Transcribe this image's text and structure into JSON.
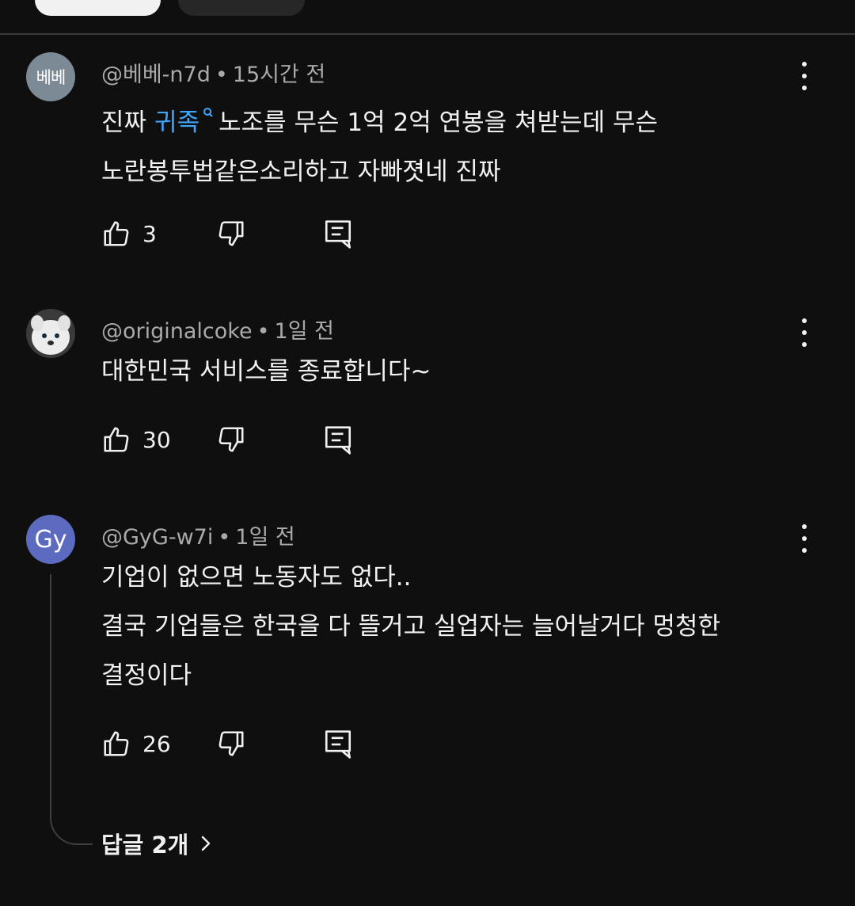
{
  "comments": [
    {
      "avatar_text": "베베",
      "author": "@베베-n7d",
      "time": "15시간 전",
      "text_prefix": "진짜",
      "hashtag": "귀족",
      "line1_rest": "노조를 무슨 1억 2억 연봉을 쳐받는데 무슨",
      "line2": "노란봉투법같은소리하고 자빠졋네 진짜",
      "likes": "3"
    },
    {
      "avatar_icon": "dog-photo-avatar",
      "author": "@originalcoke",
      "time": "1일 전",
      "line1": "대한민국 서비스를 종료합니다~",
      "likes": "30"
    },
    {
      "avatar_text": "Gy",
      "author": "@GyG-w7i",
      "time": "1일 전",
      "line1": "기업이 없으면 노동자도 없다..",
      "line2": "결국 기업들은 한국을 다 뜰거고 실업자는 늘어날거다 멍청한",
      "line3": "결정이다",
      "likes": "26",
      "replies_label": "답글 2개"
    }
  ],
  "separator": "•",
  "icons": {
    "like": "thumb-up-icon",
    "dislike": "thumb-down-icon",
    "reply": "reply-comment-icon",
    "more": "more-vertical-icon",
    "chevron": "chevron-right-icon",
    "search_mark": "search-icon"
  },
  "colors": {
    "background": "#0f0f0f",
    "text": "#f1f1f1",
    "meta": "#aaaaaa",
    "link": "#3ea6ff",
    "avatar_gy": "#5c6bc0"
  }
}
